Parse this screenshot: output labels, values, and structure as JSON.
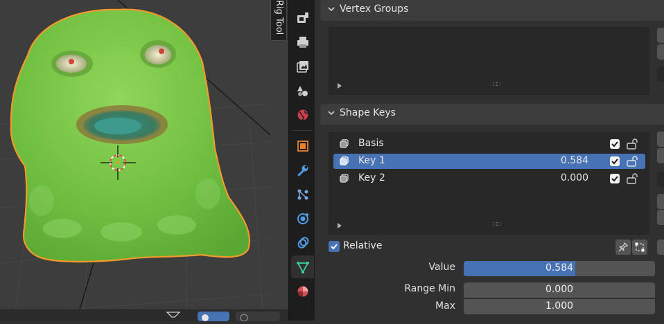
{
  "viewport": {
    "rig_tab_label": "Rig Tool"
  },
  "property_tabs": [
    {
      "icon": "tool-icon",
      "active": false
    },
    {
      "icon": "render-icon",
      "active": false
    },
    {
      "icon": "output-icon",
      "active": false
    },
    {
      "icon": "view-layer-icon",
      "active": false
    },
    {
      "icon": "scene-icon",
      "active": false
    },
    {
      "icon": "world-icon",
      "active": false
    },
    {
      "icon": "object-icon",
      "active": false
    },
    {
      "icon": "modifier-icon",
      "active": false
    },
    {
      "icon": "particles-icon",
      "active": false
    },
    {
      "icon": "physics-icon",
      "active": false
    },
    {
      "icon": "constraints-icon",
      "active": false
    },
    {
      "icon": "object-data-icon",
      "active": true
    },
    {
      "icon": "material-icon",
      "active": false
    }
  ],
  "vertex_groups": {
    "title": "Vertex Groups"
  },
  "shape_keys": {
    "title": "Shape Keys",
    "items": [
      {
        "name": "Basis",
        "value": "",
        "checked": true,
        "active": false
      },
      {
        "name": "Key 1",
        "value": "0.584",
        "checked": true,
        "active": true
      },
      {
        "name": "Key 2",
        "value": "0.000",
        "checked": true,
        "active": false
      }
    ],
    "relative_label": "Relative",
    "relative_checked": true,
    "value_label": "Value",
    "value": "0.584",
    "value_fraction": 0.584,
    "range_min_label": "Range Min",
    "range_min": "0.000",
    "max_label": "Max",
    "max": "1.000"
  },
  "colors": {
    "accent": "#4772b3",
    "panel_bg": "#303030",
    "header_bg": "#3c3c3c",
    "field_bg": "#545454",
    "list_bg": "#282828",
    "selection_outline": "#f39a2b",
    "mesh_green": "#7ac84a"
  }
}
